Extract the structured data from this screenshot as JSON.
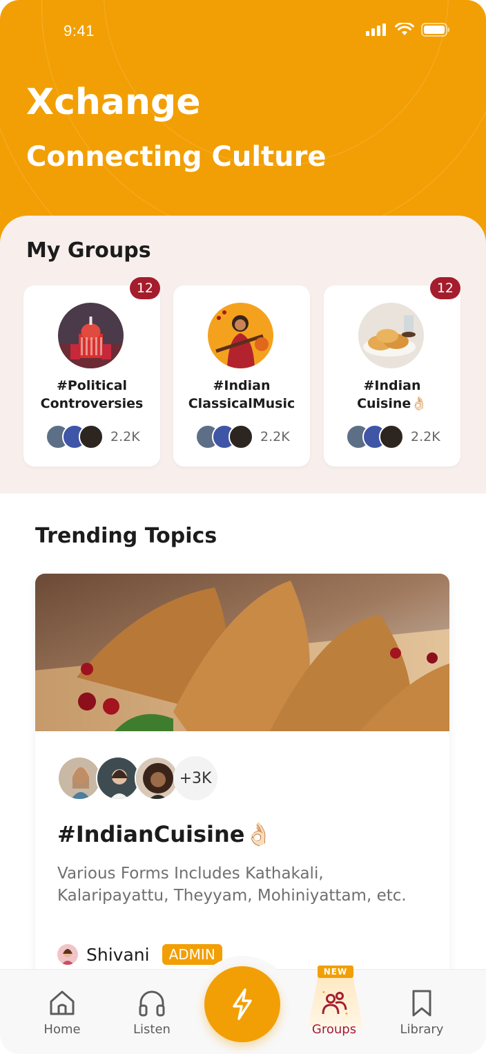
{
  "status_bar": {
    "time": "9:41"
  },
  "header": {
    "title": "Xchange",
    "subtitle": "Connecting Culture"
  },
  "my_groups": {
    "heading": "My Groups",
    "cards": [
      {
        "name_line1": "#Political",
        "name_line2": "Controversies",
        "members": "2.2K",
        "badge": "12"
      },
      {
        "name_line1": "#Indian",
        "name_line2": "ClassicalMusic",
        "members": "2.2K",
        "badge": ""
      },
      {
        "name_line1": "#Indian",
        "name_line2": "Cuisine👌🏻",
        "members": "2.2K",
        "badge": "12"
      }
    ]
  },
  "trending": {
    "heading": "Trending Topics",
    "card": {
      "more_members": "+3K",
      "title": "#IndianCuisine👌🏻",
      "description": "Various Forms Includes Kathakali, Kalaripayattu, Theyyam, Mohiniyattam, etc.",
      "author": "Shivani",
      "author_role": "ADMIN"
    }
  },
  "bottom_nav": {
    "items": [
      {
        "label": "Home",
        "icon": "home-icon"
      },
      {
        "label": "Listen",
        "icon": "headphones-icon"
      },
      {
        "label": "Groups",
        "icon": "groups-icon",
        "tag": "NEW"
      },
      {
        "label": "Library",
        "icon": "bookmark-icon"
      }
    ],
    "center_icon": "lightning-icon"
  },
  "colors": {
    "brand": "#f29f05",
    "accent": "#a51d2d",
    "groups_bg": "#f8efed"
  }
}
